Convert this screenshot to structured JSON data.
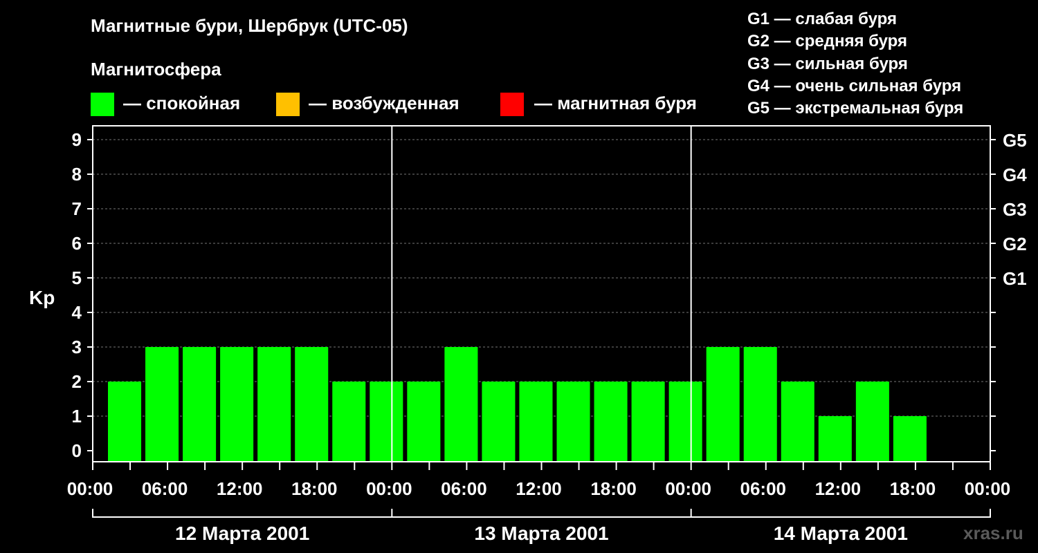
{
  "title": "Магнитные бури, Шербрук (UTC-05)",
  "legend": {
    "title": "Магнитосфера",
    "items": [
      {
        "color": "#00ff00",
        "label": "— спокойная"
      },
      {
        "color": "#ffc000",
        "label": "— возбужденная"
      },
      {
        "color": "#ff0000",
        "label": "— магнитная буря"
      }
    ]
  },
  "storm_scale": [
    "G1 — слабая буря",
    "G2 — средняя буря",
    "G3 — сильная буря",
    "G4 — очень сильная буря",
    "G5 — экстремальная буря"
  ],
  "watermark": "xras.ru",
  "chart_data": {
    "type": "bar",
    "ylabel": "Kp",
    "ylim": [
      0,
      9
    ],
    "yticks": [
      "0",
      "1",
      "2",
      "3",
      "4",
      "5",
      "6",
      "7",
      "8",
      "9"
    ],
    "right_ticks": [
      {
        "kp": 5,
        "label": "G1"
      },
      {
        "kp": 6,
        "label": "G2"
      },
      {
        "kp": 7,
        "label": "G3"
      },
      {
        "kp": 8,
        "label": "G4"
      },
      {
        "kp": 9,
        "label": "G5"
      }
    ],
    "x_tick_labels": [
      "00:00",
      "06:00",
      "12:00",
      "18:00",
      "00:00",
      "06:00",
      "12:00",
      "18:00",
      "00:00",
      "06:00",
      "12:00",
      "18:00",
      "00:00"
    ],
    "days": [
      "12 Марта 2001",
      "13 Марта 2001",
      "14 Марта 2001"
    ],
    "categories": [
      "12 Марта 2001 00:00",
      "12 Марта 2001 03:00",
      "12 Марта 2001 06:00",
      "12 Марта 2001 09:00",
      "12 Марта 2001 12:00",
      "12 Марта 2001 15:00",
      "12 Марта 2001 18:00",
      "12 Марта 2001 21:00",
      "13 Марта 2001 00:00",
      "13 Марта 2001 03:00",
      "13 Марта 2001 06:00",
      "13 Марта 2001 09:00",
      "13 Марта 2001 12:00",
      "13 Марта 2001 15:00",
      "13 Марта 2001 18:00",
      "13 Марта 2001 21:00",
      "14 Марта 2001 00:00",
      "14 Марта 2001 03:00",
      "14 Марта 2001 06:00",
      "14 Марта 2001 09:00",
      "14 Марта 2001 12:00",
      "14 Марта 2001 15:00",
      "14 Марта 2001 18:00",
      "14 Марта 2001 21:00"
    ],
    "values": [
      2,
      3,
      3,
      3,
      3,
      3,
      2,
      2,
      2,
      3,
      2,
      2,
      2,
      2,
      2,
      2,
      3,
      3,
      2,
      1,
      2,
      1,
      null,
      null
    ],
    "bar_colors": [
      "#00ff00",
      "#00ff00",
      "#00ff00",
      "#00ff00",
      "#00ff00",
      "#00ff00",
      "#00ff00",
      "#00ff00",
      "#00ff00",
      "#00ff00",
      "#00ff00",
      "#00ff00",
      "#00ff00",
      "#00ff00",
      "#00ff00",
      "#00ff00",
      "#00ff00",
      "#00ff00",
      "#00ff00",
      "#00ff00",
      "#00ff00",
      "#00ff00",
      null,
      null
    ],
    "grid": true
  }
}
